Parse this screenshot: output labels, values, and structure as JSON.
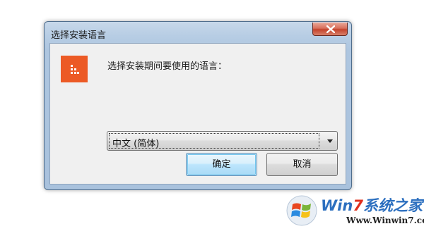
{
  "window": {
    "title": "选择安装语言"
  },
  "dialog": {
    "prompt": "选择安装期间要使用的语言：",
    "language_select": {
      "selected": "中文 (简体)"
    },
    "ok_label": "确定",
    "cancel_label": "取消"
  },
  "icons": {
    "close": "close-icon",
    "app_logo": "app-logo-icon",
    "dropdown": "chevron-down-icon"
  },
  "colors": {
    "app_logo_bg": "#ec5a25",
    "close_button": "#c4432c",
    "default_button_border": "#3c7fb1"
  },
  "watermark": {
    "brand_prefix": "Win",
    "brand_seven": "7",
    "brand_suffix": "系统之家",
    "url": "Www.Winwin7.com"
  }
}
